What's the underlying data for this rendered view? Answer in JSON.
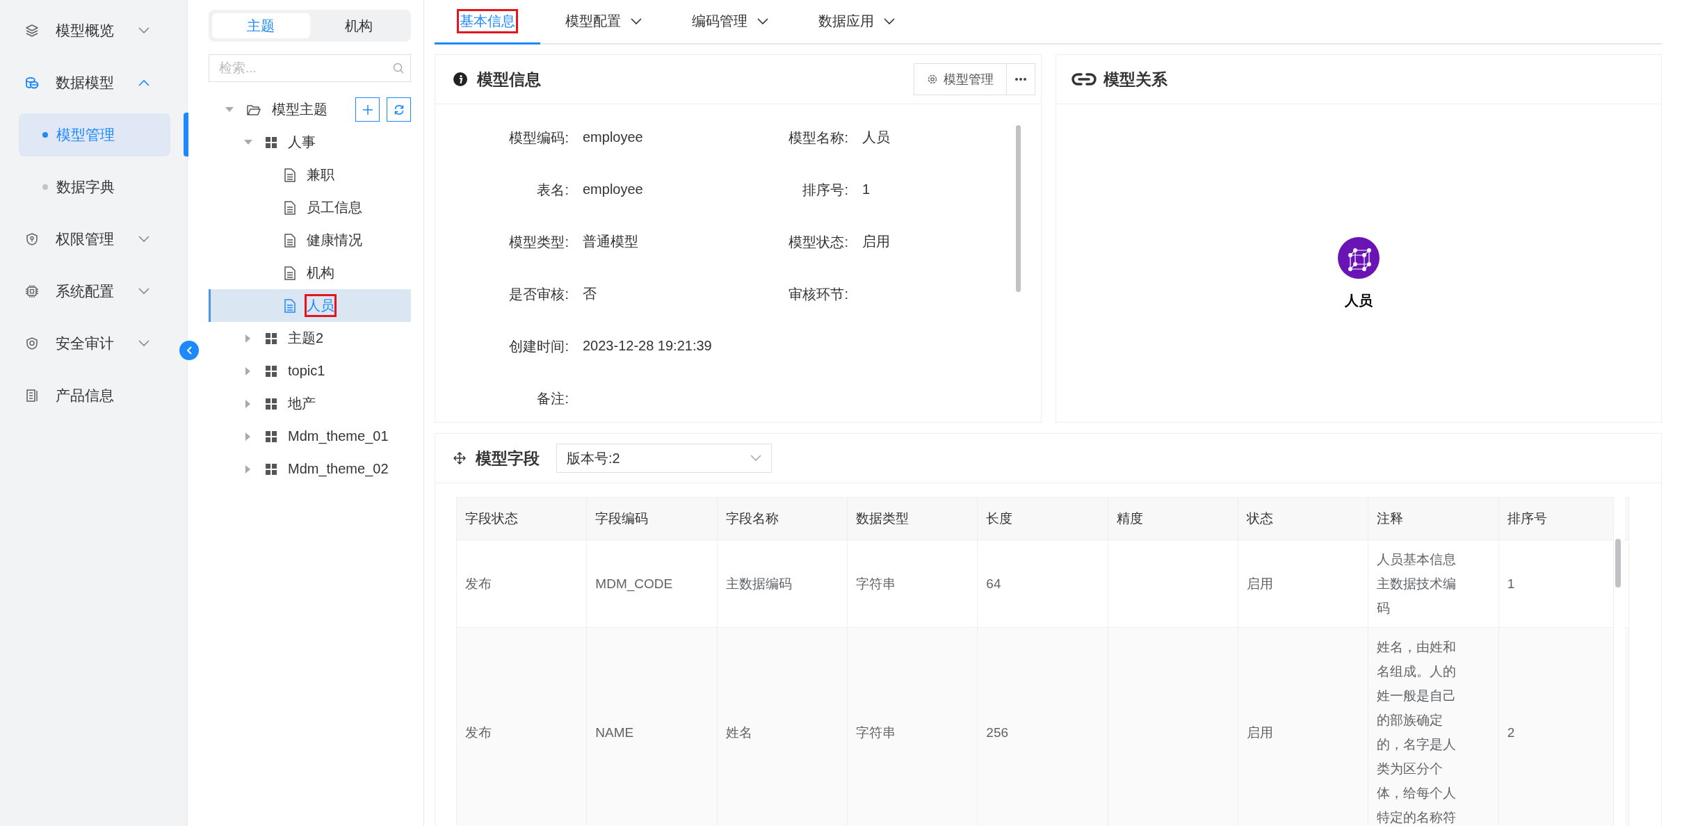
{
  "sidebar": {
    "items": [
      {
        "label": "模型概览",
        "kind": "group",
        "expanded": false,
        "selected": false
      },
      {
        "label": "数据模型",
        "kind": "group",
        "expanded": true,
        "selected": true,
        "children": [
          {
            "label": "模型管理",
            "selected": true
          },
          {
            "label": "数据字典",
            "selected": false
          }
        ]
      },
      {
        "label": "权限管理",
        "kind": "group",
        "expanded": false,
        "selected": false
      },
      {
        "label": "系统配置",
        "kind": "group",
        "expanded": false,
        "selected": false
      },
      {
        "label": "安全审计",
        "kind": "group",
        "expanded": false,
        "selected": false
      },
      {
        "label": "产品信息",
        "kind": "link",
        "selected": false
      }
    ]
  },
  "tree": {
    "tabs": [
      {
        "label": "主题",
        "selected": true
      },
      {
        "label": "机构",
        "selected": false
      }
    ],
    "search": {
      "placeholder": "检索..."
    },
    "root": {
      "label": "模型主题",
      "kind": "folder",
      "expanded": true,
      "selected": false,
      "highlighted": false,
      "children": [
        {
          "label": "人事",
          "kind": "group",
          "expanded": true,
          "selected": false,
          "highlighted": false,
          "children": [
            {
              "label": "兼职",
              "kind": "doc",
              "selected": false,
              "highlighted": false
            },
            {
              "label": "员工信息",
              "kind": "doc",
              "selected": false,
              "highlighted": false
            },
            {
              "label": "健康情况",
              "kind": "doc",
              "selected": false,
              "highlighted": false
            },
            {
              "label": "机构",
              "kind": "doc",
              "selected": false,
              "highlighted": false
            },
            {
              "label": "人员",
              "kind": "doc",
              "selected": true,
              "highlighted": true
            }
          ]
        },
        {
          "label": "主题2",
          "kind": "group",
          "expanded": false,
          "selected": false,
          "highlighted": false
        },
        {
          "label": "topic1",
          "kind": "group",
          "expanded": false,
          "selected": false,
          "highlighted": false
        },
        {
          "label": "地产",
          "kind": "group",
          "expanded": false,
          "selected": false,
          "highlighted": false
        },
        {
          "label": "Mdm_theme_01",
          "kind": "group",
          "expanded": false,
          "selected": false,
          "highlighted": false
        },
        {
          "label": "Mdm_theme_02",
          "kind": "group",
          "expanded": false,
          "selected": false,
          "highlighted": false
        }
      ]
    }
  },
  "tabs": [
    {
      "label": "基本信息",
      "selected": true,
      "highlighted": true,
      "dropdown": false
    },
    {
      "label": "模型配置",
      "selected": false,
      "highlighted": false,
      "dropdown": true
    },
    {
      "label": "编码管理",
      "selected": false,
      "highlighted": false,
      "dropdown": true
    },
    {
      "label": "数据应用",
      "selected": false,
      "highlighted": false,
      "dropdown": true
    }
  ],
  "model_info": {
    "title": "模型信息",
    "manage_button": "模型管理",
    "rows": [
      [
        {
          "label": "模型编码:",
          "value": "employee"
        },
        {
          "label": "模型名称:",
          "value": "人员"
        }
      ],
      [
        {
          "label": "表名:",
          "value": "employee"
        },
        {
          "label": "排序号:",
          "value": "1"
        }
      ],
      [
        {
          "label": "模型类型:",
          "value": "普通模型"
        },
        {
          "label": "模型状态:",
          "value": "启用"
        }
      ],
      [
        {
          "label": "是否审核:",
          "value": "否"
        },
        {
          "label": "审核环节:"
        }
      ],
      [
        {
          "label": "创建时间:",
          "value": "2023-12-28 19:21:39"
        }
      ],
      [
        {
          "label": "备注:"
        }
      ]
    ]
  },
  "model_relation": {
    "title": "模型关系",
    "node": {
      "label": "人员"
    }
  },
  "model_fields": {
    "title": "模型字段",
    "version": "版本号:2",
    "table": {
      "columns": [
        "字段状态",
        "字段编码",
        "字段名称",
        "数据类型",
        "长度",
        "精度",
        "状态",
        "注释",
        "排序号"
      ],
      "rows": [
        [
          "发布",
          "MDM_CODE",
          "主数据编码",
          "字符串",
          "64",
          "",
          "启用",
          "人员基本信息主数据技术编码",
          "1"
        ],
        [
          "发布",
          "NAME",
          "姓名",
          "字符串",
          "256",
          "",
          "启用",
          "姓名，由姓和名组成。人的姓一般是自己的部族确定的，名字是人类为区分个体，给每个人特定的名称符",
          "2"
        ]
      ]
    }
  }
}
